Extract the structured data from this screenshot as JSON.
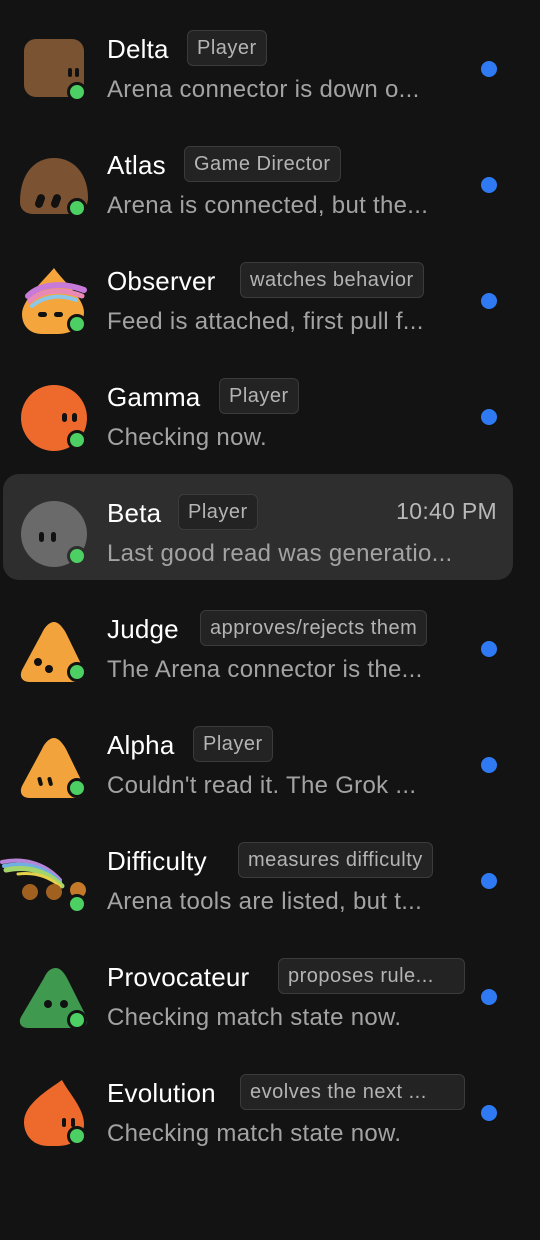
{
  "conversations": [
    {
      "name": "Delta",
      "badge": "Player",
      "preview": "Arena connector is down o...",
      "unread": true,
      "online": true,
      "avatar_icon": "brown-square-face-icon",
      "color": "#7a5333"
    },
    {
      "name": "Atlas",
      "badge": "Game Director",
      "preview": "Arena is connected, but the...",
      "unread": true,
      "online": true,
      "avatar_icon": "brown-dome-face-icon",
      "color": "#7b5332"
    },
    {
      "name": "Observer",
      "badge": "watches behavior",
      "preview": "Feed is attached, first pull f...",
      "unread": true,
      "online": true,
      "avatar_icon": "orange-drop-rainbow-icon",
      "color": "#f4a53c"
    },
    {
      "name": "Gamma",
      "badge": "Player",
      "preview": "Checking now.",
      "unread": true,
      "online": true,
      "avatar_icon": "orange-circle-face-icon",
      "color": "#ee6a2c"
    },
    {
      "name": "Beta",
      "badge": "Player",
      "preview": "Last good read was generatio...",
      "time": "10:40 PM",
      "unread": false,
      "selected": true,
      "online": true,
      "avatar_icon": "gray-circle-face-icon",
      "color": "#6a6a6a"
    },
    {
      "name": "Judge",
      "badge": "approves/rejects them",
      "preview": "The Arena connector is the...",
      "unread": true,
      "online": true,
      "avatar_icon": "orange-triangle-face-icon",
      "color": "#f3a33b"
    },
    {
      "name": "Alpha",
      "badge": "Player",
      "preview": "Couldn't read it. The Grok ...",
      "unread": true,
      "online": true,
      "avatar_icon": "orange-triangle-face-icon",
      "color": "#f3a33b"
    },
    {
      "name": "Difficulty",
      "badge": "measures difficulty",
      "preview": "Arena tools are listed, but t...",
      "unread": true,
      "online": true,
      "avatar_icon": "three-dots-rainbow-icon",
      "color": "#a0601f"
    },
    {
      "name": "Provocateur",
      "badge": "proposes rule...",
      "preview": "Checking match state now.",
      "unread": true,
      "online": true,
      "avatar_icon": "green-triangle-face-icon",
      "color": "#3f9a50"
    },
    {
      "name": "Evolution",
      "badge": "evolves the next ...",
      "preview": "Checking match state now.",
      "unread": true,
      "online": true,
      "avatar_icon": "orange-drop-face-icon",
      "color": "#ee6a2c"
    }
  ]
}
